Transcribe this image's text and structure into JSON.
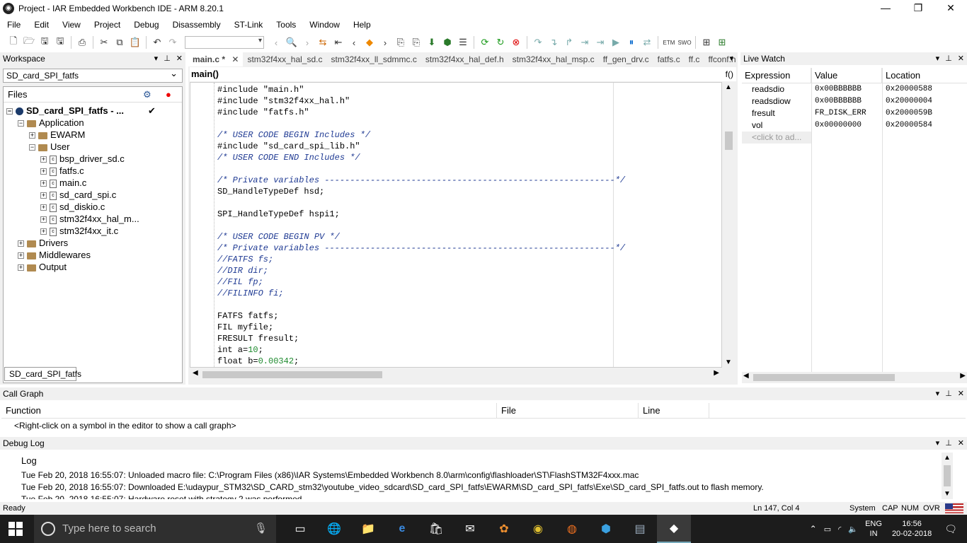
{
  "window": {
    "title": "Project - IAR Embedded Workbench IDE - ARM 8.20.1"
  },
  "menu": [
    "File",
    "Edit",
    "View",
    "Project",
    "Debug",
    "Disassembly",
    "ST-Link",
    "Tools",
    "Window",
    "Help"
  ],
  "workspace": {
    "title": "Workspace",
    "config": "SD_card_SPI_fatfs",
    "files_label": "Files",
    "tab": "SD_card_SPI_fatfs",
    "tree": {
      "project": "SD_card_SPI_fatfs - ...",
      "application": "Application",
      "ewarm": "EWARM",
      "user": "User",
      "user_files": [
        "bsp_driver_sd.c",
        "fatfs.c",
        "main.c",
        "sd_card_spi.c",
        "sd_diskio.c",
        "stm32f4xx_hal_m...",
        "stm32f4xx_it.c"
      ],
      "drivers": "Drivers",
      "middlewares": "Middlewares",
      "output": "Output"
    }
  },
  "editor": {
    "tabs": [
      "main.c *",
      "stm32f4xx_hal_sd.c",
      "stm32f4xx_ll_sdmmc.c",
      "stm32f4xx_hal_def.h",
      "stm32f4xx_hal_msp.c",
      "ff_gen_drv.c",
      "fatfs.c",
      "ff.c",
      "ffconf.h"
    ],
    "function": "main()",
    "lines": [
      "#include \"main.h\"",
      "#include \"stm32f4xx_hal.h\"",
      "#include \"fatfs.h\"",
      "",
      "/* USER CODE BEGIN Includes */",
      "#include \"sd_card_spi_lib.h\"",
      "/* USER CODE END Includes */",
      "",
      "/* Private variables ---------------------------------------------------------*/",
      "SD_HandleTypeDef hsd;",
      "",
      "SPI_HandleTypeDef hspi1;",
      "",
      "/* USER CODE BEGIN PV */",
      "/* Private variables ---------------------------------------------------------*/",
      "//FATFS fs;",
      "//DIR dir;",
      "//FIL fp;",
      "//FILINFO fi;",
      "",
      "FATFS fatfs;",
      "FIL myfile;",
      "FRESULT fresult;",
      "int a=10;",
      "float b=0.00342;"
    ]
  },
  "live_watch": {
    "title": "Live Watch",
    "headers": [
      "Expression",
      "Value",
      "Location"
    ],
    "rows": [
      {
        "expr": "readsdio",
        "value": "0x00BBBBBB",
        "loc": "0x20000588"
      },
      {
        "expr": "readsdiow",
        "value": "0x00BBBBBB",
        "loc": "0x20000004"
      },
      {
        "expr": "fresult",
        "value": "FR_DISK_ERR",
        "loc": "0x2000059B"
      },
      {
        "expr": "vol",
        "value": "0x00000000",
        "loc": "0x20000584"
      }
    ],
    "add_placeholder": "<click to ad..."
  },
  "call_graph": {
    "title": "Call Graph",
    "headers": [
      "Function",
      "File",
      "Line"
    ],
    "message": "<Right-click on a symbol in the editor to show a call graph>"
  },
  "debug_log": {
    "title": "Debug Log",
    "header": "Log",
    "lines": [
      "Tue Feb 20, 2018 16:55:07: Unloaded macro file: C:\\Program Files (x86)\\IAR Systems\\Embedded Workbench 8.0\\arm\\config\\flashloader\\ST\\FlashSTM32F4xxx.mac",
      "Tue Feb 20, 2018 16:55:07: Downloaded E:\\udaypur_STM32\\SD_CARD_stm32\\youtube_video_sdcard\\SD_card_SPI_fatfs\\EWARM\\SD_card_SPI_fatfs\\Exe\\SD_card_SPI_fatfs.out to flash memory.",
      "Tue Feb 20, 2018 16:55:07: Hardware reset with strategy 2 was performed"
    ]
  },
  "status": {
    "left": "Ready",
    "position": "Ln 147, Col 4",
    "system": "System",
    "caps": "CAP",
    "num": "NUM",
    "ovr": "OVR"
  },
  "taskbar": {
    "search_placeholder": "Type here to search",
    "lang": "ENG",
    "region": "IN",
    "time": "16:56",
    "date": "20-02-2018"
  }
}
